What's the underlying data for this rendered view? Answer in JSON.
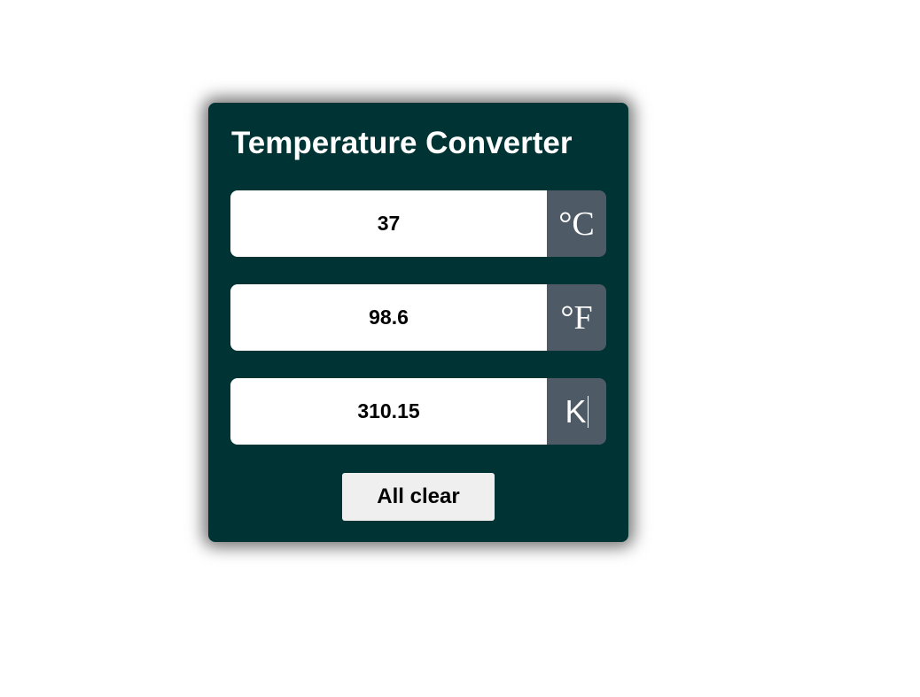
{
  "converter": {
    "title": "Temperature Converter",
    "fields": [
      {
        "value": "37",
        "unit": "°C"
      },
      {
        "value": "98.6",
        "unit": "°F"
      },
      {
        "value": "310.15",
        "unit": "K"
      }
    ],
    "clear_label": "All clear"
  },
  "colors": {
    "card_background": "#003333",
    "unit_background": "#4e5a66",
    "button_background": "#efefef"
  }
}
